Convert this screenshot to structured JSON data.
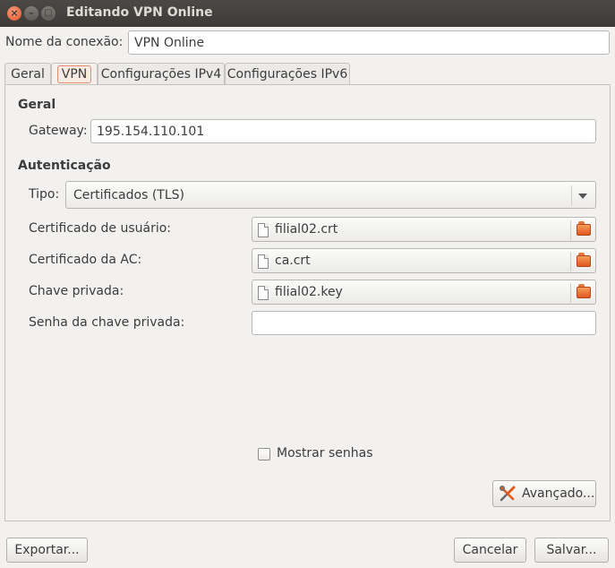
{
  "window": {
    "title": "Editando VPN Online",
    "close_glyph": "×",
    "minimize_glyph": "–",
    "maximize_glyph": "□"
  },
  "connection_name": {
    "label": "Nome da conexão:",
    "value": "VPN Online"
  },
  "tabs": [
    {
      "label": "Geral",
      "active": false
    },
    {
      "label": "VPN",
      "active": true
    },
    {
      "label": "Configurações IPv4",
      "active": false
    },
    {
      "label": "Configurações IPv6",
      "active": false
    }
  ],
  "general_section": {
    "heading": "Geral",
    "gateway_label": "Gateway:",
    "gateway_value": "195.154.110.101"
  },
  "auth_section": {
    "heading": "Autenticação",
    "type_label": "Tipo:",
    "type_value": "Certificados (TLS)",
    "user_cert_label": "Certificado de usuário:",
    "user_cert_file": "filial02.crt",
    "ca_cert_label": "Certificado da AC:",
    "ca_cert_file": "ca.crt",
    "private_key_label": "Chave privada:",
    "private_key_file": "filial02.key",
    "key_password_label": "Senha da chave privada:",
    "key_password_value": ""
  },
  "show_passwords": {
    "label": "Mostrar senhas",
    "checked": false
  },
  "buttons": {
    "advanced": "Avançado...",
    "export": "Exportar...",
    "cancel": "Cancelar",
    "save": "Salvar..."
  },
  "icons": {
    "file": "document-icon",
    "folder": "folder-open-icon",
    "tools": "tools-icon",
    "dropdown": "chevron-down-icon"
  },
  "colors": {
    "titlebar": "#3c3b37",
    "close_button": "#e0532b",
    "accent": "#e58c6a",
    "background": "#f2f1f0"
  }
}
